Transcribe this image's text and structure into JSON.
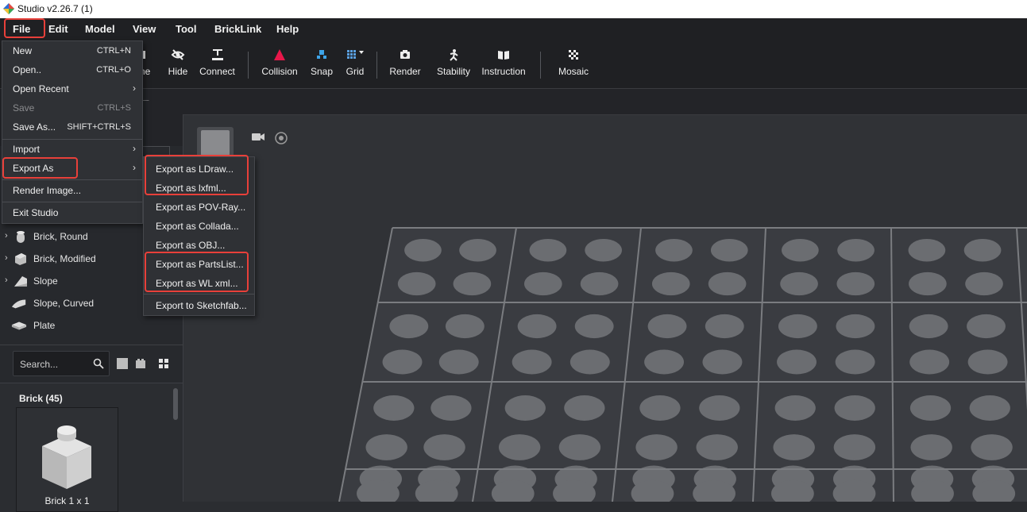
{
  "window": {
    "title": "Studio v2.26.7 (1)"
  },
  "menubar": [
    "File",
    "Edit",
    "Model",
    "View",
    "Tool",
    "BrickLink",
    "Help"
  ],
  "toolbar": {
    "partial_label": "ne",
    "items": [
      "Hide",
      "Connect",
      "Collision",
      "Snap",
      "Grid",
      "Render",
      "Stability",
      "Instruction",
      "Mosaic"
    ]
  },
  "file_menu": {
    "new": {
      "label": "New",
      "shortcut": "CTRL+N"
    },
    "open": {
      "label": "Open..",
      "shortcut": "CTRL+O"
    },
    "open_recent": {
      "label": "Open Recent"
    },
    "save": {
      "label": "Save",
      "shortcut": "CTRL+S"
    },
    "save_as": {
      "label": "Save As...",
      "shortcut": "SHIFT+CTRL+S"
    },
    "import": {
      "label": "Import"
    },
    "export_as": {
      "label": "Export As"
    },
    "render_image": {
      "label": "Render Image..."
    },
    "exit": {
      "label": "Exit Studio"
    }
  },
  "export_menu": [
    "Export as LDraw...",
    "Export as lxfml...",
    "Export as POV-Ray...",
    "Export as Collada...",
    "Export as OBJ...",
    "Export as PartsList...",
    "Export as WL xml...",
    "Export to Sketchfab..."
  ],
  "categories": [
    "Brick, Round",
    "Brick, Modified",
    "Slope",
    "Slope, Curved",
    "Plate"
  ],
  "search": {
    "placeholder": "Search..."
  },
  "parts": {
    "group_title": "Brick (45)",
    "first_part": "Brick 1 x 1"
  },
  "colors": {
    "highlight": "#e8403a",
    "collision_icon": "#e8174a",
    "snap_icon": "#3da4e8",
    "grid_icon": "#5aa0e0"
  }
}
